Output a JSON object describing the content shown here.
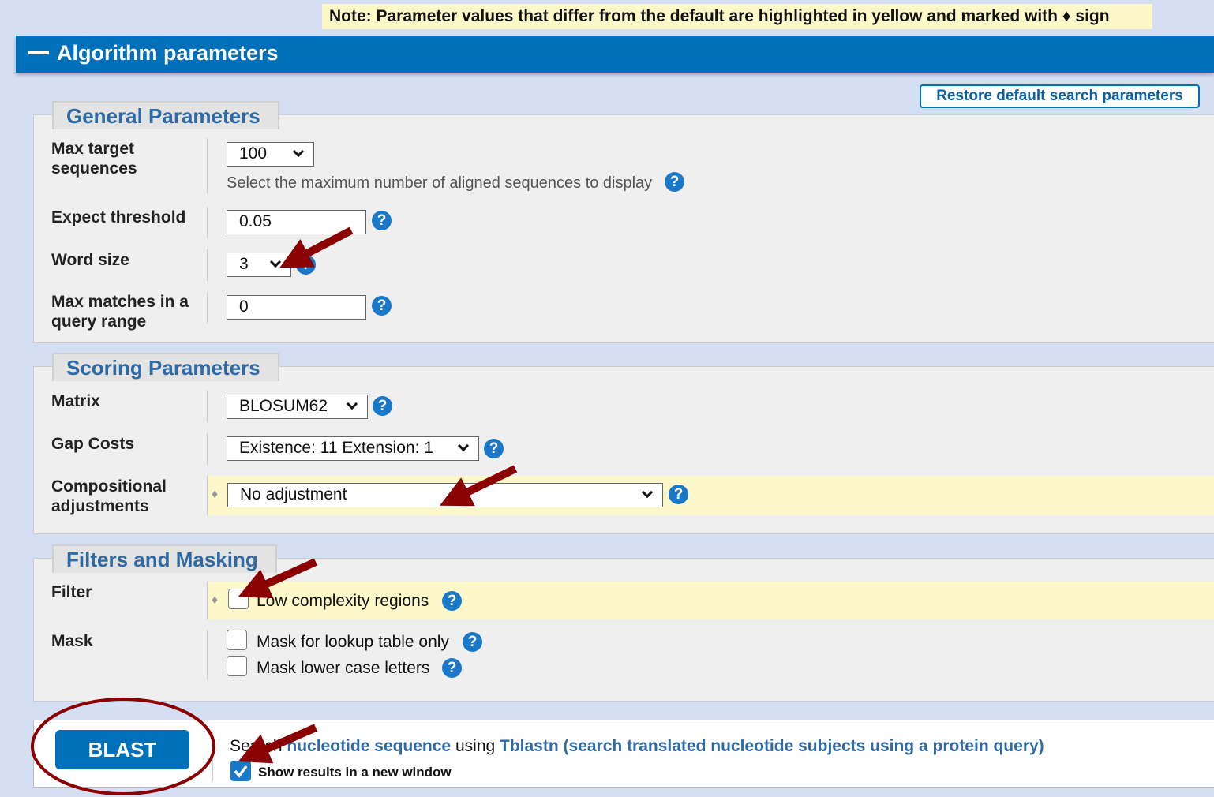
{
  "note": "Note: Parameter values that differ from the default are highlighted in yellow and marked with ♦ sign",
  "header": {
    "title": "Algorithm parameters",
    "collapse_icon": "minus-icon"
  },
  "restore_button": "Restore default search parameters",
  "general": {
    "title": "General Parameters",
    "max_target": {
      "label": "Max target sequences",
      "value": "100",
      "hint": "Select the maximum number of aligned sequences to display"
    },
    "expect": {
      "label": "Expect threshold",
      "value": "0.05"
    },
    "word_size": {
      "label": "Word size",
      "value": "3"
    },
    "max_matches": {
      "label": "Max matches in a query range",
      "value": "0"
    }
  },
  "scoring": {
    "title": "Scoring Parameters",
    "matrix": {
      "label": "Matrix",
      "value": "BLOSUM62"
    },
    "gap": {
      "label": "Gap Costs",
      "value": "Existence: 11 Extension: 1"
    },
    "comp": {
      "label": "Compositional adjustments",
      "value": "No adjustment",
      "marker": "♦"
    }
  },
  "filters": {
    "title": "Filters and Masking",
    "filter": {
      "label": "Filter",
      "option": "Low complexity regions",
      "checked": false,
      "marker": "♦"
    },
    "mask": {
      "label": "Mask",
      "options": [
        {
          "label": "Mask for lookup table only",
          "checked": false
        },
        {
          "label": "Mask lower case letters",
          "checked": false
        }
      ]
    }
  },
  "submit": {
    "button": "BLAST",
    "search_pre": "Search",
    "search_target": "nucleotide sequence",
    "search_mid": "using",
    "program": "Tblastn (search translated nucleotide subjects using a protein query)",
    "new_window": "Show results in a new window",
    "new_window_checked": true
  },
  "help_symbol": "?",
  "colors": {
    "accent": "#0070bb",
    "highlight": "#fdf8c9",
    "annotation": "#8b0000"
  }
}
